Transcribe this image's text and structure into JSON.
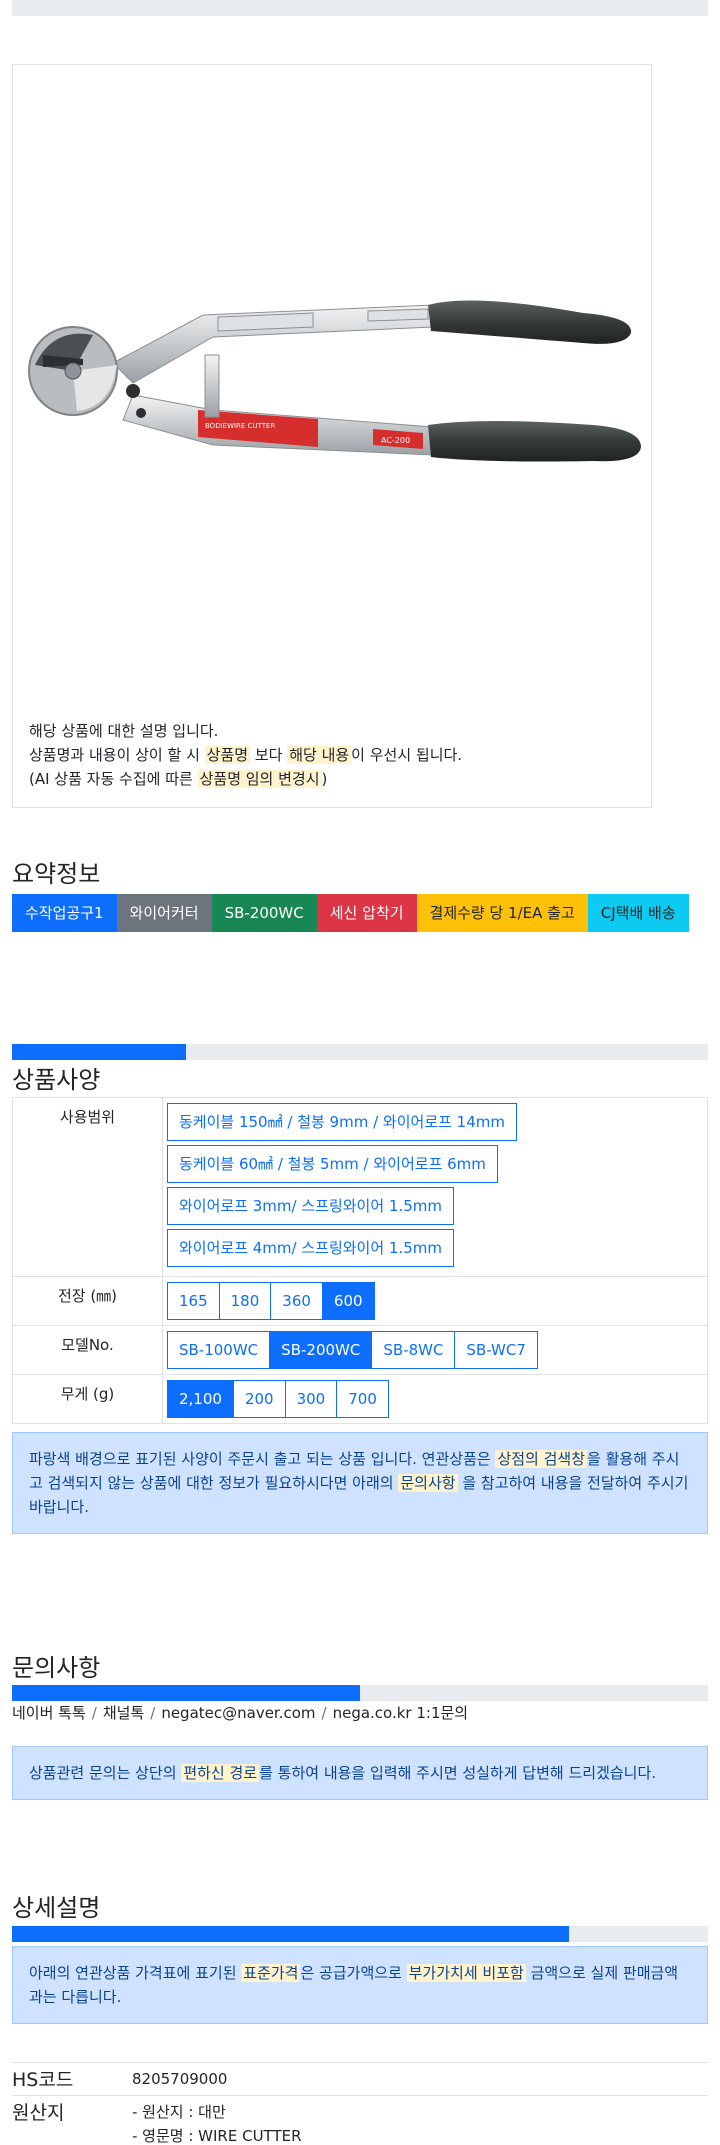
{
  "product_image": {
    "alt": "wire cutter",
    "label_text": "BODIEWIRE CUTTER",
    "model_tag": "AC-200",
    "note_line1": "해당 상품에 대한 설명 입니다.",
    "note_line2_a": "상품명과 내용이 상이 할 시 ",
    "note_line2_h1": "상품명",
    "note_line2_b": " 보다 ",
    "note_line2_h2": "해당 내용",
    "note_line2_c": "이 우선시 됩니다.",
    "note_line3_a": "(AI 상품 자동 수집에 따른 ",
    "note_line3_h": "상품명 임의 변경시",
    "note_line3_b": ")"
  },
  "summary": {
    "title": "요약정보",
    "badges": [
      "수작업공구1",
      "와이어커터",
      "SB-200WC",
      "세신 압착기",
      "결제수량 당 1/EA 출고",
      "CJ택배 배송"
    ]
  },
  "spec": {
    "title": "상품사양",
    "progress": 0.25,
    "usage_label": "사용범위",
    "usage_options": [
      "동케이블 150㎟ / 철봉 9mm / 와이어로프 14mm",
      "동케이블 60㎟ / 철봉 5mm / 와이어로프 6mm",
      "와이어로프 3mm/ 스프링와이어 1.5mm",
      "와이어로프 4mm/ 스프링와이어 1.5mm"
    ],
    "length_label": "전장 (㎜)",
    "length_options": [
      "165",
      "180",
      "360",
      "600"
    ],
    "length_selected": "600",
    "model_label": "모델No.",
    "model_options": [
      "SB-100WC",
      "SB-200WC",
      "SB-8WC",
      "SB-WC7"
    ],
    "model_selected": "SB-200WC",
    "weight_label": "무게 (g)",
    "weight_options": [
      "2,100",
      "200",
      "300",
      "700"
    ],
    "weight_selected": "2,100",
    "notice_a": "파랑색 배경으로 표기된 사양이 주문시 출고 되는 상품 입니다. 연관상품은 ",
    "notice_h1": "상점의 검색창",
    "notice_b": "을 활용해 주시고 검색되지 않는 상품에 대한 정보가 필요하시다면 아래의 ",
    "notice_h2": "문의사항",
    "notice_c": " 을 참고하여 내용을 전달하여 주시기 바랍니다."
  },
  "inquiry": {
    "title": "문의사항",
    "progress": 0.5,
    "channels": [
      "네이버 톡톡",
      "채널톡",
      "negatec@naver.com",
      "nega.co.kr 1:1문의"
    ],
    "notice_a": "상품관련 문의는 상단의 ",
    "notice_h": "편하신 경로",
    "notice_b": "를 통하여 내용을 입력해 주시면 성실하게 답변해 드리겠습니다."
  },
  "detail": {
    "title": "상세설명",
    "progress": 0.8,
    "notice_a": "아래의 연관상품 가격표에 표기된 ",
    "notice_h1": "표준가격",
    "notice_b": "은 공급가액으로 ",
    "notice_h2": "부가가치세 비포함",
    "notice_c": " 금액으로 실제 판매금액과는 다릅니다.",
    "hs_label": "HS코드",
    "hs_value": "8205709000",
    "origin_label": "원산지",
    "origin_line1": "- 원산지 : 대만",
    "origin_line2": "- 영문명 : WIRE CUTTER"
  },
  "colors": {
    "primary": "#0d6efd",
    "highlight": "#fff3cd",
    "alert_bg": "#cfe2ff",
    "handle": "#3b4240"
  }
}
